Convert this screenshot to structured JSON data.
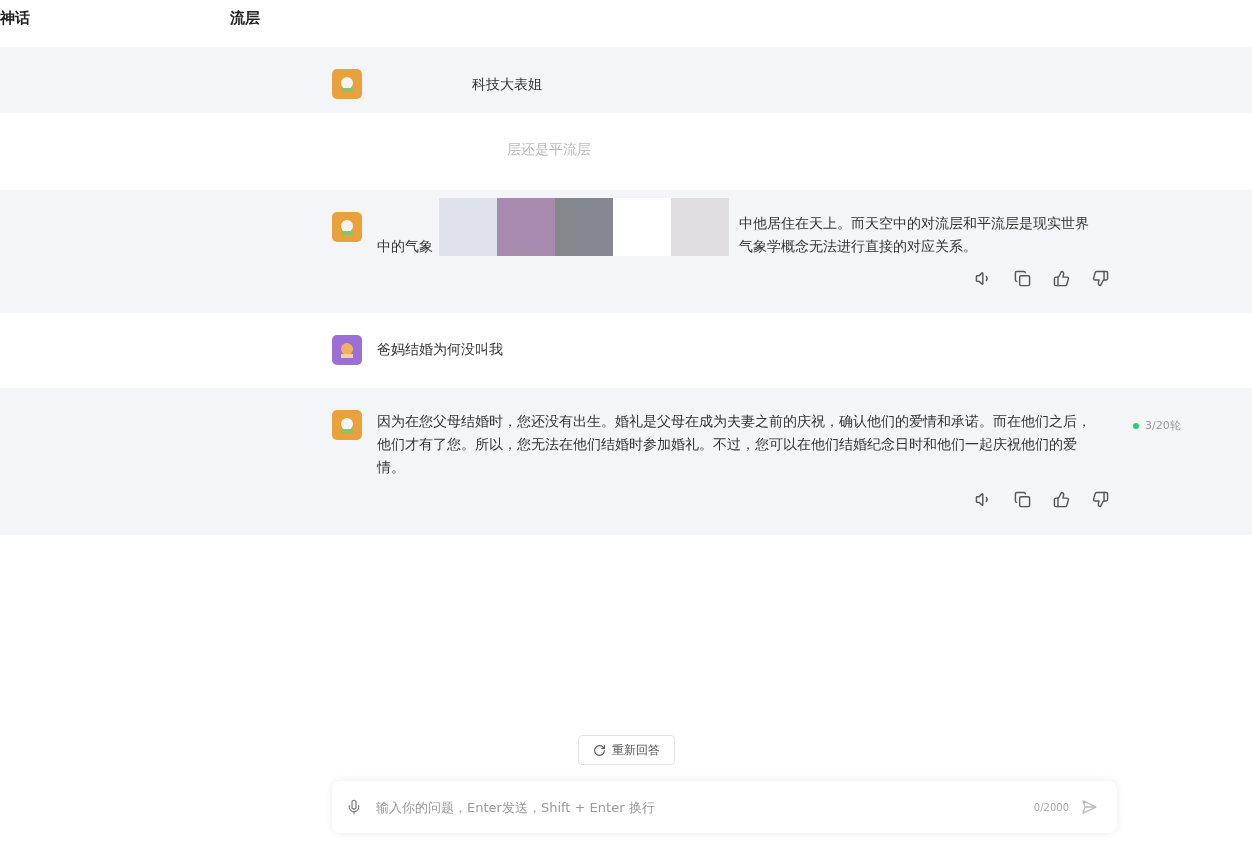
{
  "title_fragments": [
    "神话",
    "流层"
  ],
  "messages": [
    {
      "kind": "user-name",
      "user_avatar": false,
      "lines": [
        "科技大表姐"
      ]
    },
    {
      "kind": "faint",
      "lines": [
        "层还是平流层"
      ]
    },
    {
      "kind": "bot-redacted",
      "user_avatar": false,
      "left_text": "中的气象",
      "right_lines": [
        "中他居住在天上。而天空中的对流层和平流层是现实世界",
        "气象学概念无法进行直接的对应关系。"
      ]
    },
    {
      "kind": "user",
      "user_avatar": true,
      "lines": [
        "爸妈结婚为何没叫我"
      ]
    },
    {
      "kind": "bot",
      "user_avatar": false,
      "lines": [
        "因为在您父母结婚时，您还没有出生。婚礼是父母在成为夫妻之前的庆祝，确认他们的爱情和承诺。而在他们之后，他们才有了您。所以，您无法在他们结婚时参加婚礼。不过，您可以在他们结婚纪念日时和他们一起庆祝他们的爱情。"
      ],
      "counter": "3/20轮"
    }
  ],
  "regenerate_button": "重新回答",
  "input": {
    "placeholder": "输入你的问题，Enter发送，Shift + Enter 换行",
    "count": "0/2000"
  }
}
